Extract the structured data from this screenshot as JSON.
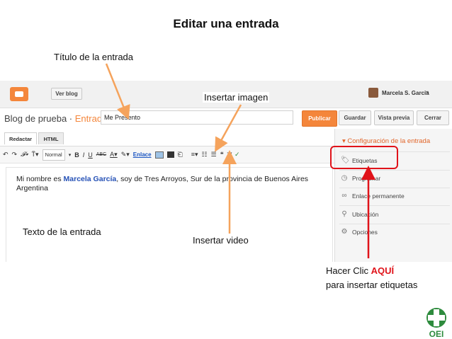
{
  "slide": {
    "title": "Editar una entrada",
    "annotations": {
      "post_title": "Título de la entrada",
      "insert_image": "Insertar imagen",
      "post_text": "Texto de la entrada",
      "insert_video": "Insertar video",
      "click_pre": "Hacer Clic ",
      "click_here": "AQUÍ",
      "click_post": "para insertar etiquetas"
    },
    "colors": {
      "arrow_orange": "#f5a35c",
      "arrow_red": "#e0131a",
      "highlight_box": "#e0131a"
    }
  },
  "app": {
    "header": {
      "view_blog": "Ver blog",
      "user_name": "Marcela S. Garcia",
      "user_caret": "▾"
    },
    "post": {
      "blog_name": "Blog de prueba",
      "separator": " · ",
      "section": "Entrada",
      "title_value": "Me Presento"
    },
    "actions": {
      "publish": "Publicar",
      "save": "Guardar",
      "preview": "Vista previa",
      "close": "Cerrar"
    },
    "tabs": {
      "compose": "Redactar",
      "html": "HTML"
    },
    "toolbar": {
      "font_size": "Normal",
      "link_label": "Enlace"
    },
    "editor": {
      "text_before": "Mi nombre es ",
      "name": "Marcela García",
      "text_after": ", soy de Tres Arroyos, Sur de la provincia de Buenos Aires Argentina"
    },
    "sidebar": {
      "header": "▾ Configuración de la entrada",
      "items": [
        {
          "label": "Etiquetas",
          "icon": "tag-icon"
        },
        {
          "label": "Programar",
          "icon": "clock-icon"
        },
        {
          "label": "Enlace permanente",
          "icon": "link-icon"
        },
        {
          "label": "Ubicación",
          "icon": "pin-icon"
        },
        {
          "label": "Opciones",
          "icon": "gear-icon"
        }
      ]
    }
  },
  "brand": {
    "logo_text": "OEI",
    "color": "#2e8b3d"
  }
}
